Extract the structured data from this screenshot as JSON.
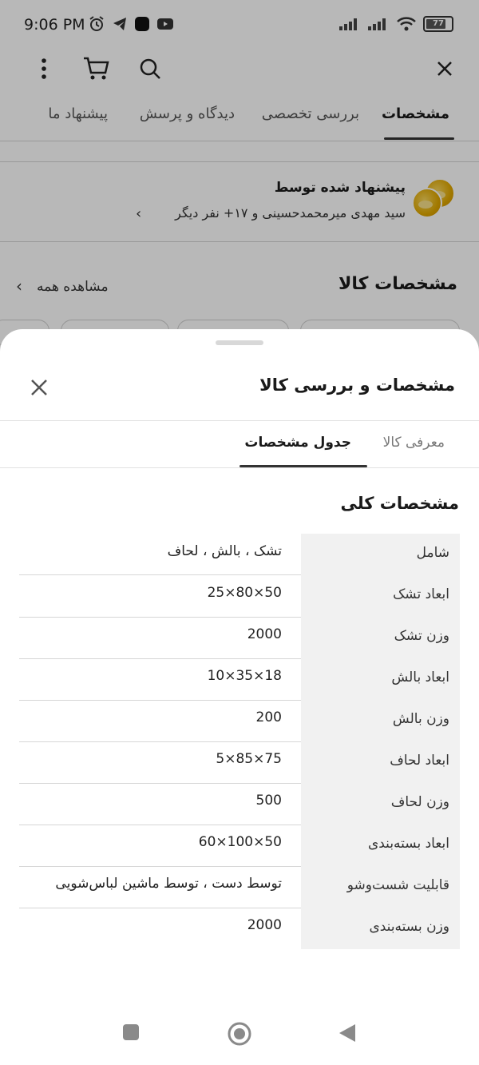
{
  "status_bar": {
    "time": "9:06 PM",
    "battery": "77"
  },
  "top_tabs": [
    {
      "label": "مشخصات",
      "active": true
    },
    {
      "label": "بررسی تخصصی",
      "active": false
    },
    {
      "label": "دیدگاه و پرسش",
      "active": false
    },
    {
      "label": "پیشنهاد ما",
      "active": false
    }
  ],
  "suggestion": {
    "title": "پیشنهاد شده توسط",
    "subtitle": "سید مهدی میرمحمدحسینی و ۱۷+ نفر دیگر"
  },
  "specs_header": {
    "title": "مشخصات کالا",
    "see_all": "مشاهده همه"
  },
  "sheet": {
    "title": "مشخصات و بررسی کالا",
    "tabs": [
      {
        "label": "معرفی کالا",
        "active": false
      },
      {
        "label": "جدول مشخصات",
        "active": true
      }
    ],
    "section_title": "مشخصات کلی",
    "rows": [
      {
        "label": "شامل",
        "value": "تشک ، بالش ، لحاف"
      },
      {
        "label": "ابعاد تشک",
        "value": "25×80×50"
      },
      {
        "label": "وزن تشک",
        "value": "2000"
      },
      {
        "label": "ابعاد بالش",
        "value": "10×35×18"
      },
      {
        "label": "وزن بالش",
        "value": "200"
      },
      {
        "label": "ابعاد لحاف",
        "value": "5×85×75"
      },
      {
        "label": "وزن لحاف",
        "value": "500"
      },
      {
        "label": "ابعاد بسته‌بندی",
        "value": "60×100×50"
      },
      {
        "label": "قابلیت شست‌وشو",
        "value": "توسط دست ، توسط ماشین لباس‌شویی"
      },
      {
        "label": "وزن بسته‌بندی",
        "value": "2000"
      }
    ]
  },
  "icons": {
    "close": "close-icon",
    "search": "search-icon",
    "cart": "cart-icon",
    "more": "more-vertical-icon",
    "nav_square": "recent-apps-icon",
    "nav_home": "home-icon",
    "nav_back": "back-icon"
  }
}
